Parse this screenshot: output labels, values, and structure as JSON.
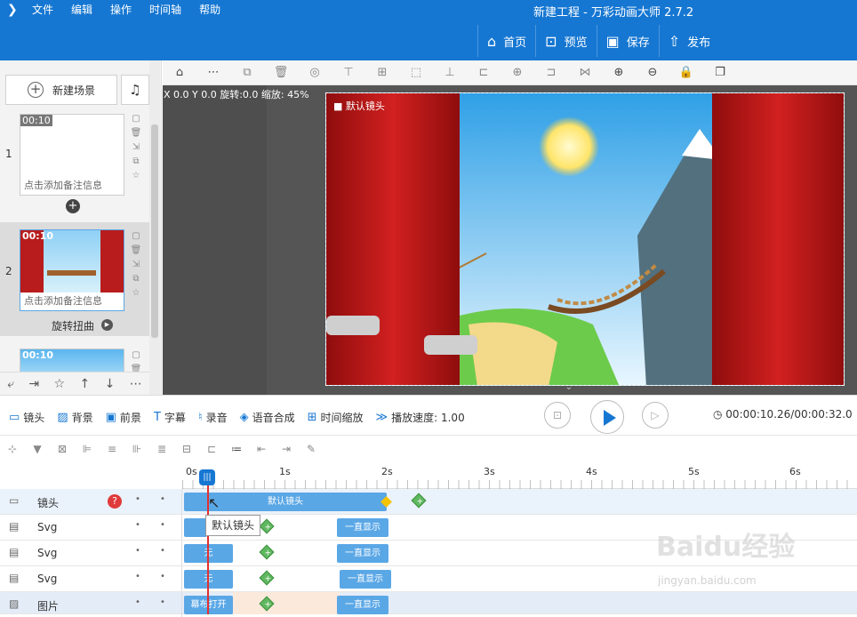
{
  "menu": [
    "文件",
    "编辑",
    "操作",
    "时间轴",
    "帮助"
  ],
  "window_title": "新建工程 - 万彩动画大师 2.7.2",
  "top_buttons": [
    {
      "label": "首页",
      "icon": "home-icon"
    },
    {
      "label": "预览",
      "icon": "preview-icon"
    },
    {
      "label": "保存",
      "icon": "save-icon"
    },
    {
      "label": "发布",
      "icon": "publish-icon"
    }
  ],
  "left": {
    "new_scene": "新建场景",
    "scenes": [
      {
        "num": "1",
        "duration": "00:10",
        "note": "点击添加备注信息"
      },
      {
        "num": "2",
        "duration": "00:10",
        "note": "点击添加备注信息",
        "transition": "旋转扭曲"
      },
      {
        "num": "3",
        "duration": "00:10"
      }
    ]
  },
  "canvas": {
    "coord_text": "X 0.0 Y 0.0 旋转:0.0 缩放: 45%",
    "camera_label": "默认镜头"
  },
  "playbar": {
    "tools": [
      "镜头",
      "背景",
      "前景",
      "字幕",
      "录音",
      "语音合成",
      "时间缩放",
      "播放速度: 1.00"
    ],
    "time": "00:00:10.26/00:00:32.0"
  },
  "timeline": {
    "ruler": [
      "0s",
      "1s",
      "2s",
      "3s",
      "4s",
      "5s",
      "6s"
    ],
    "tracks": [
      {
        "name": "镜头",
        "block": "默认镜头"
      },
      {
        "name": "Svg",
        "block": "",
        "end": "一直显示"
      },
      {
        "name": "Svg",
        "block": "无",
        "end": "一直显示"
      },
      {
        "name": "Svg",
        "block": "无",
        "end": "一直显示"
      },
      {
        "name": "图片",
        "block": "幕布打开",
        "end": "一直显示"
      }
    ],
    "tooltip": "默认镜头"
  },
  "watermark": "Baidu经验",
  "watermark_url": "jingyan.baidu.com"
}
